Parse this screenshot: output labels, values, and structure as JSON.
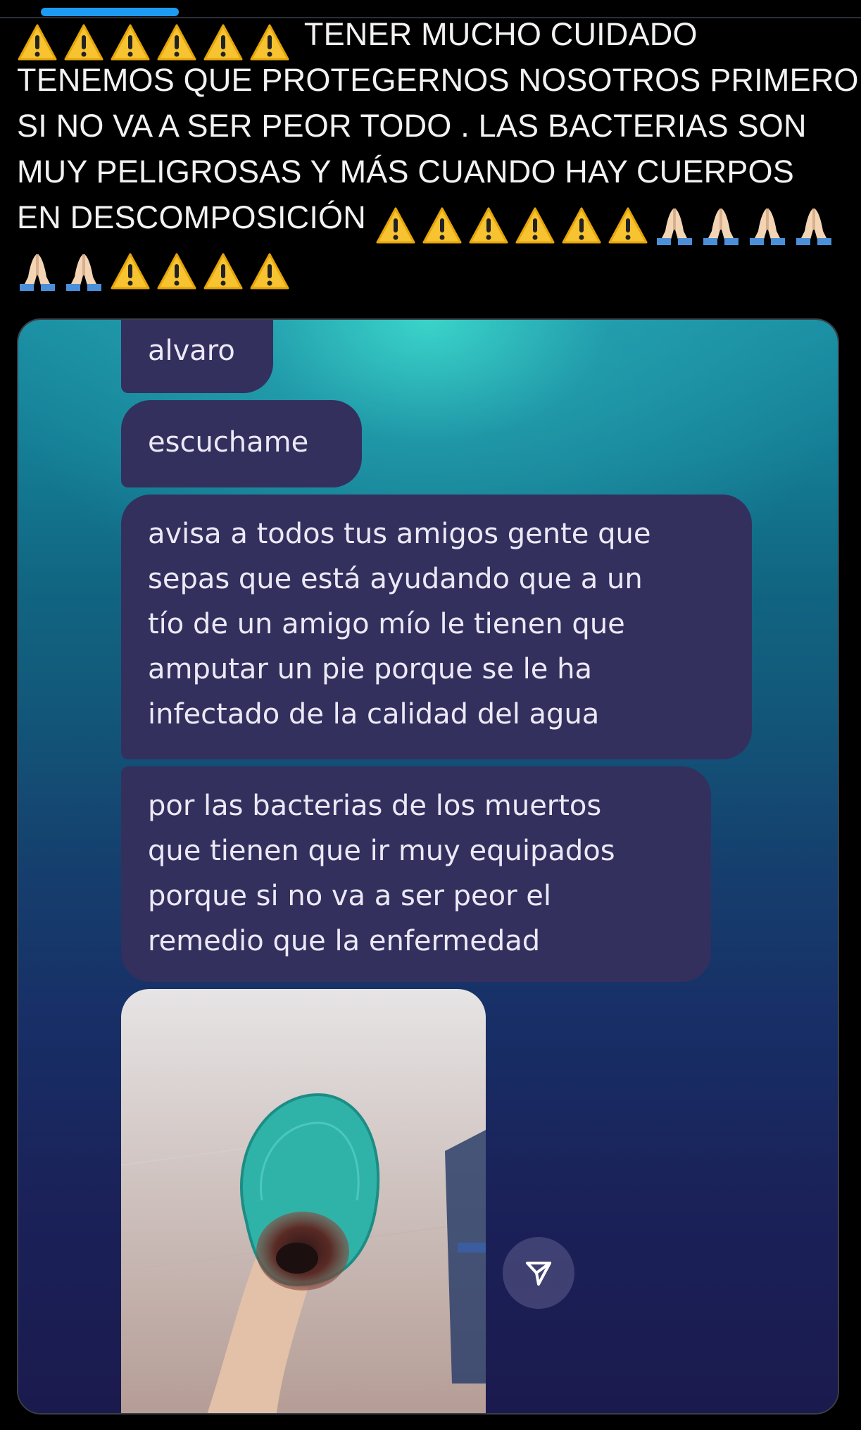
{
  "post": {
    "lines": [
      {
        "lead_warnings": 6,
        "lead_prayers": 0,
        "text": "TENER MUCHO CUIDADO",
        "trail_warnings": 0,
        "trail_prayers": 0
      },
      {
        "lead_warnings": 0,
        "lead_prayers": 0,
        "text": "TENEMOS QUE PROTEGERNOS NOSOTROS PRIMERO",
        "trail_warnings": 0,
        "trail_prayers": 0
      },
      {
        "lead_warnings": 0,
        "lead_prayers": 0,
        "text": "SI NO VA A SER PEOR TODO . LAS BACTERIAS SON",
        "trail_warnings": 0,
        "trail_prayers": 0
      },
      {
        "lead_warnings": 0,
        "lead_prayers": 0,
        "text": "MUY PELIGROSAS Y MÁS CUANDO HAY CUERPOS",
        "trail_warnings": 0,
        "trail_prayers": 0
      },
      {
        "lead_warnings": 0,
        "lead_prayers": 0,
        "text": "EN DESCOMPOSICIÓN",
        "trail_warnings": 6,
        "trail_prayers": 4
      },
      {
        "lead_warnings": 0,
        "lead_prayers": 2,
        "text": "",
        "trail_warnings": 4,
        "trail_prayers": 0
      }
    ],
    "warning_icon": "warning-emoji",
    "prayer_icon": "folded-hands-emoji"
  },
  "chat": {
    "messages": [
      {
        "lines": [
          "alvaro"
        ]
      },
      {
        "lines": [
          "escuchame"
        ]
      },
      {
        "lines": [
          "avisa a todos tus amigos gente que",
          "sepas que está ayudando que a un",
          "tío de un amigo mío le tienen que",
          "amputar un pie porque se le ha",
          "infectado de la calidad del agua"
        ]
      },
      {
        "lines": [
          "por las bacterias de los muertos",
          "que tienen que ir muy equipados",
          "porque si no va a ser peor el",
          "remedio que la enfermedad"
        ]
      }
    ],
    "photo_icon": "injured-foot-photo",
    "share_icon": "send-icon"
  },
  "colors": {
    "background": "#000000",
    "text": "#f2f2f2",
    "bubble": "#33305e",
    "progress": "#1d9bf0"
  }
}
